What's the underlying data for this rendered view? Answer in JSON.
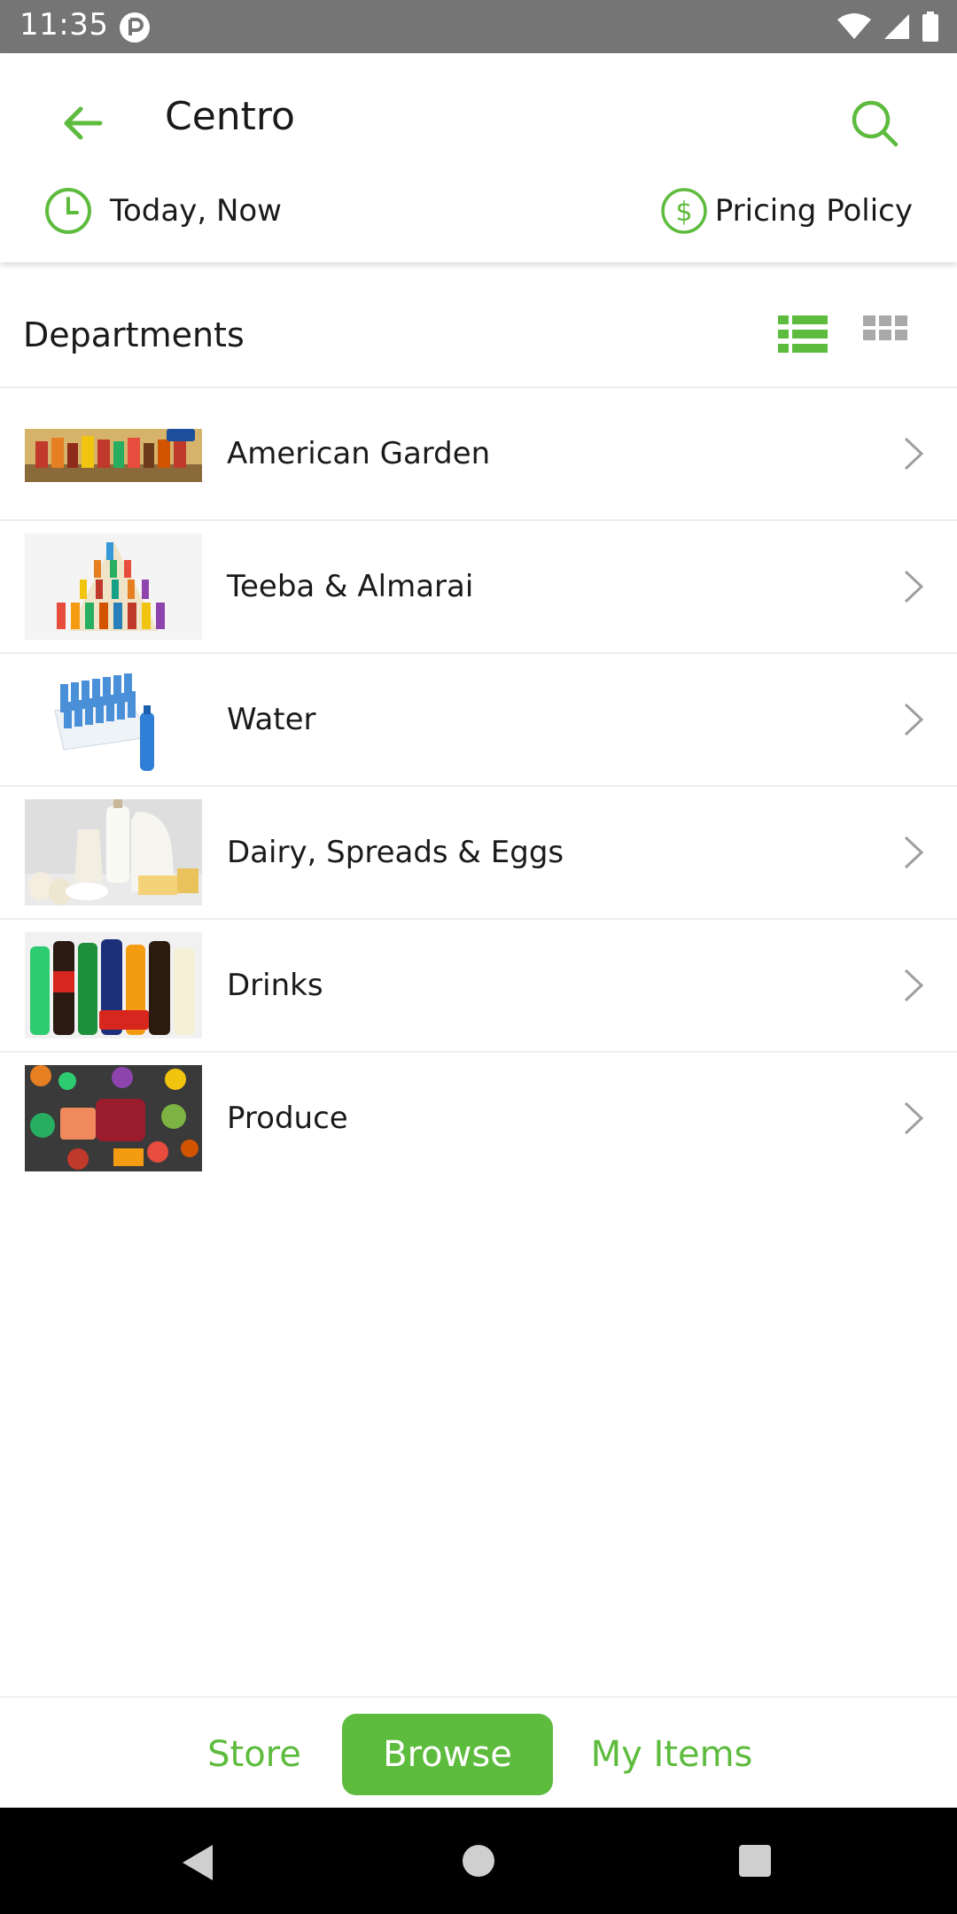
{
  "status_bar": {
    "time": "11:35"
  },
  "header": {
    "title": "Centro",
    "time_label": "Today, Now",
    "pricing_label": "Pricing Policy"
  },
  "departments": {
    "title": "Departments",
    "items": [
      {
        "label": "American Garden"
      },
      {
        "label": "Teeba & Almarai"
      },
      {
        "label": "Water"
      },
      {
        "label": "Dairy, Spreads & Eggs"
      },
      {
        "label": "Drinks"
      },
      {
        "label": "Produce"
      }
    ]
  },
  "bottom_nav": {
    "store": "Store",
    "browse": "Browse",
    "my_items": "My Items",
    "active": "Browse"
  },
  "colors": {
    "accent": "#5dbb3d",
    "status_bar": "#757575",
    "divider": "#ededed",
    "nav_bar": "#000000"
  },
  "icons": {
    "back": "arrow-left-icon",
    "search": "search-icon",
    "clock": "clock-icon",
    "dollar": "dollar-circle-icon",
    "list_view": "list-view-icon",
    "grid_view": "grid-view-icon",
    "chevron": "chevron-right-icon"
  }
}
